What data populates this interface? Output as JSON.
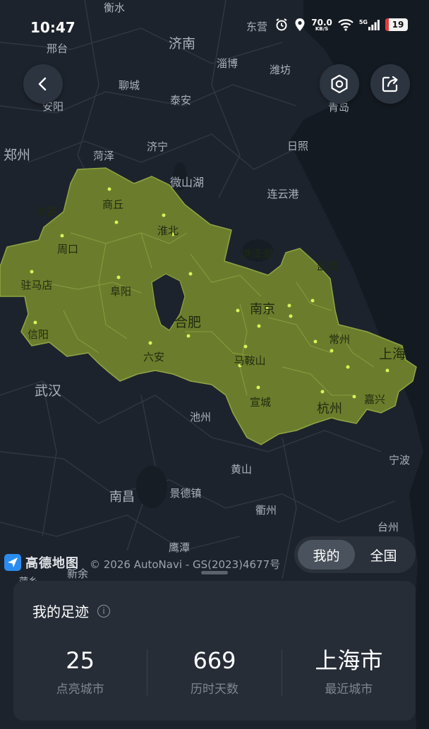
{
  "status_bar": {
    "time": "10:47",
    "network_speed_value": "70.0",
    "network_speed_unit": "KB/S",
    "cellular": "5G",
    "battery_level": "19"
  },
  "map": {
    "colors": {
      "background": "#1d232c",
      "land_grid": "#2a323d",
      "water": "#151b22",
      "visited_region": "#6b7d2c",
      "visited_border": "#8fa545",
      "city_dot": "#d9f25a"
    },
    "labels": [
      "衡水",
      "济南",
      "东营",
      "淄博",
      "潍坊",
      "邢台",
      "聊城",
      "泰安",
      "安阳",
      "青岛",
      "郑州",
      "菏泽",
      "济宁",
      "日照",
      "微山湖",
      "连云港",
      "许昌",
      "商丘",
      "淮北",
      "周口",
      "洪泽湖",
      "盐城",
      "驻马店",
      "阜阳",
      "南京",
      "合肥",
      "常州",
      "信阳",
      "上海",
      "六安",
      "马鞍山",
      "武汉",
      "宣城",
      "杭州",
      "嘉兴",
      "池州",
      "宁波",
      "黄山",
      "南昌",
      "景德镇",
      "衢州",
      "台州",
      "鹰潭",
      "新余",
      "萍乡"
    ]
  },
  "map_attribution": {
    "logo_text": "高德地图",
    "copyright": "© 2026 AutoNavi - GS(2023)4677号"
  },
  "toggle": {
    "mine": "我的",
    "all": "全国",
    "selected": "我的"
  },
  "panel": {
    "title": "我的足迹",
    "stats": [
      {
        "value": "25",
        "label": "点亮城市"
      },
      {
        "value": "669",
        "label": "历时天数"
      },
      {
        "value": "上海市",
        "label": "最近城市"
      }
    ]
  }
}
